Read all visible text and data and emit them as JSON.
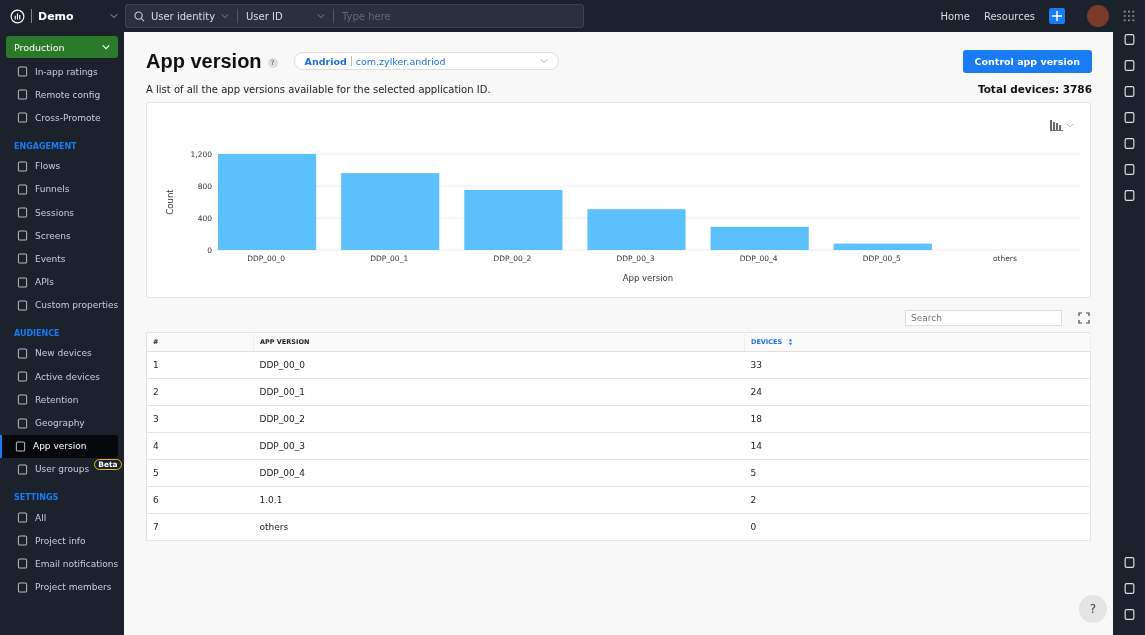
{
  "topbar": {
    "project": "Demo",
    "search_scope": "User identity",
    "search_field": "User ID",
    "search_placeholder": "Type here",
    "links": [
      "Home",
      "Resources"
    ]
  },
  "environment": "Production",
  "sidebar": {
    "top_items": [
      {
        "label": "In-app ratings",
        "selected": false
      },
      {
        "label": "Remote config",
        "selected": false
      },
      {
        "label": "Cross-Promote",
        "selected": false
      }
    ],
    "sections": [
      {
        "title": "ENGAGEMENT",
        "items": [
          {
            "label": "Flows",
            "selected": false
          },
          {
            "label": "Funnels",
            "selected": false
          },
          {
            "label": "Sessions",
            "selected": false
          },
          {
            "label": "Screens",
            "selected": false
          },
          {
            "label": "Events",
            "selected": false
          },
          {
            "label": "APIs",
            "selected": false
          },
          {
            "label": "Custom properties",
            "selected": false
          }
        ]
      },
      {
        "title": "AUDIENCE",
        "items": [
          {
            "label": "New devices",
            "selected": false
          },
          {
            "label": "Active devices",
            "selected": false
          },
          {
            "label": "Retention",
            "selected": false
          },
          {
            "label": "Geography",
            "selected": false
          },
          {
            "label": "App version",
            "selected": true
          },
          {
            "label": "User groups",
            "selected": false,
            "badge": "Beta"
          }
        ]
      },
      {
        "title": "SETTINGS",
        "items": [
          {
            "label": "All",
            "selected": false
          },
          {
            "label": "Project info",
            "selected": false
          },
          {
            "label": "Email notifications",
            "selected": false
          },
          {
            "label": "Project members",
            "selected": false
          }
        ]
      }
    ]
  },
  "page": {
    "title": "App version",
    "help_mark": "?",
    "app_selector": {
      "platform": "Andriod",
      "app_id": "com.zylker.andriod"
    },
    "action_button": "Control app version",
    "description": "A list of all the app versions available for the selected application ID.",
    "total": "Total devices: 3786"
  },
  "chart_data": {
    "type": "bar",
    "xlabel": "App version",
    "ylabel": "Count",
    "categories": [
      "DDP_00_0",
      "DDP_00_1",
      "DDP_00_2",
      "DDP_00_3",
      "DDP_00_4",
      "DDP_00_5",
      "others"
    ],
    "values": [
      1200,
      960,
      750,
      510,
      290,
      80,
      0
    ],
    "ylim": [
      0,
      1200
    ],
    "yticks": [
      0,
      {
        "value": 400,
        "label": "400"
      },
      {
        "value": 800,
        "label": "800"
      },
      {
        "value": 1200,
        "label": "1,200"
      }
    ]
  },
  "table": {
    "search_placeholder": "Search",
    "columns": [
      "#",
      "APP VERSION",
      "DEVICES"
    ],
    "rows": [
      [
        "1",
        "DDP_00_0",
        "33"
      ],
      [
        "2",
        "DDP_00_1",
        "24"
      ],
      [
        "3",
        "DDP_00_2",
        "18"
      ],
      [
        "4",
        "DDP_00_3",
        "14"
      ],
      [
        "5",
        "DDP_00_4",
        "5"
      ],
      [
        "6",
        "1.0.1",
        "2"
      ],
      [
        "7",
        "others",
        "0"
      ]
    ]
  },
  "help_button": "?"
}
